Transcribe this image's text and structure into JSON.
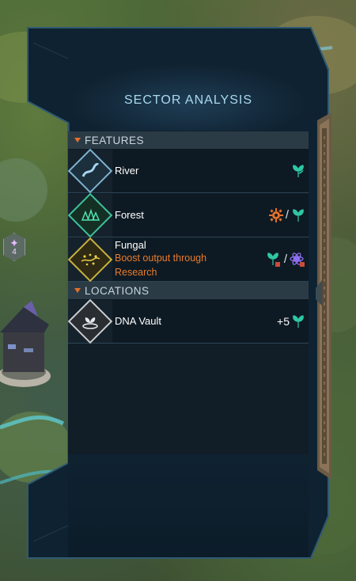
{
  "panel": {
    "title": "SECTOR ANALYSIS"
  },
  "features": {
    "header": "FEATURES",
    "items": [
      {
        "name": "River",
        "sub": "",
        "icon": "river-icon",
        "yield_text": ""
      },
      {
        "name": "Forest",
        "sub": "",
        "icon": "forest-icon",
        "yield_text": ""
      },
      {
        "name": "Fungal",
        "sub": "Boost output through Research",
        "sub_line1": "Boost output through",
        "sub_line2": "Research",
        "icon": "fungal-icon",
        "yield_text": ""
      }
    ]
  },
  "locations": {
    "header": "LOCATIONS",
    "items": [
      {
        "name": "DNA Vault",
        "icon": "dna-vault-icon",
        "yield_text": "+5"
      }
    ]
  },
  "map_marker": {
    "value": "4"
  },
  "colors": {
    "accent_orange": "#e4702a",
    "teal_yield": "#2fc7a4",
    "panel_border": "#2f5a73",
    "title": "#a9d9ee"
  }
}
